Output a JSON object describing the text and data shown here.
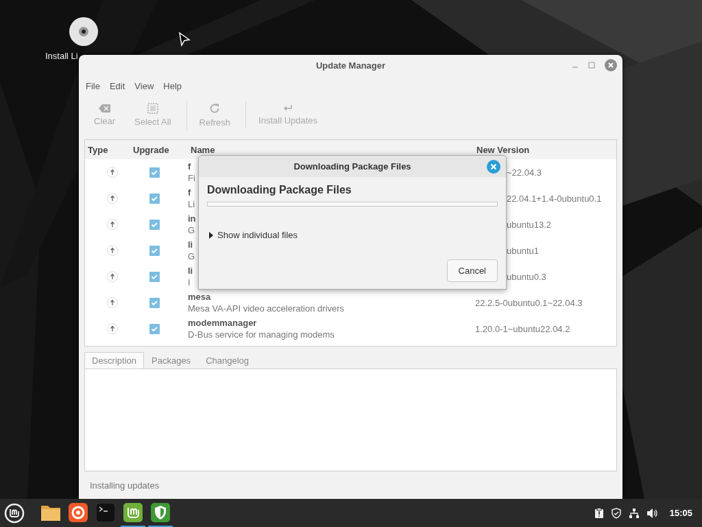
{
  "desktop": {
    "icons": [
      {
        "label": "Install Li"
      }
    ]
  },
  "window": {
    "title": "Update Manager",
    "menu": [
      "File",
      "Edit",
      "View",
      "Help"
    ],
    "toolbar": [
      {
        "kind": "clear",
        "label": "Clear",
        "disabled": true,
        "separator_before": false
      },
      {
        "kind": "select",
        "label": "Select All",
        "disabled": true,
        "separator_before": false
      },
      {
        "kind": "refresh",
        "label": "Refresh",
        "disabled": true,
        "separator_before": true
      },
      {
        "kind": "install",
        "label": "Install Updates",
        "disabled": true,
        "separator_before": true
      }
    ],
    "table": {
      "columns": [
        "Type",
        "Upgrade",
        "Name",
        "New Version"
      ],
      "rows": [
        {
          "checked": true,
          "name": "f",
          "description": "Fi",
          "version": "~22.04.3"
        },
        {
          "checked": true,
          "name": "f",
          "description": "Li",
          "version": "22.04.1+1.4-0ubuntu0.1"
        },
        {
          "checked": true,
          "name": "in",
          "description": "G",
          "version": "ubuntu13.2"
        },
        {
          "checked": true,
          "name": "li",
          "description": "G",
          "version": "ubuntu1"
        },
        {
          "checked": true,
          "name": "li",
          "description": "I",
          "version": "ubuntu0.3"
        },
        {
          "checked": true,
          "name": "mesa",
          "description": "Mesa VA-API video acceleration drivers",
          "version": "22.2.5-0ubuntu0.1~22.04.3"
        },
        {
          "checked": true,
          "name": "modemmanager",
          "description": "D-Bus service for managing modems",
          "version": "1.20.0-1~ubuntu22.04.2"
        }
      ]
    },
    "tabs": [
      {
        "label": "Description",
        "selected": true
      },
      {
        "label": "Packages",
        "selected": false
      },
      {
        "label": "Changelog",
        "selected": false
      }
    ],
    "status_bar": "Installing updates"
  },
  "dialog": {
    "title": "Downloading Package Files",
    "heading": "Downloading Package Files",
    "progress": {
      "level": 0
    },
    "expander": {
      "label": "Show individual files",
      "expanded": false
    },
    "buttons": [
      "Cancel"
    ]
  },
  "taskbar": {
    "apps": [
      {
        "kind": "files",
        "active": false
      },
      {
        "kind": "browser",
        "active": false
      },
      {
        "kind": "terminal",
        "active": false
      },
      {
        "kind": "updater",
        "active": true
      },
      {
        "kind": "shield",
        "active": true
      }
    ],
    "clock": "15:05"
  }
}
